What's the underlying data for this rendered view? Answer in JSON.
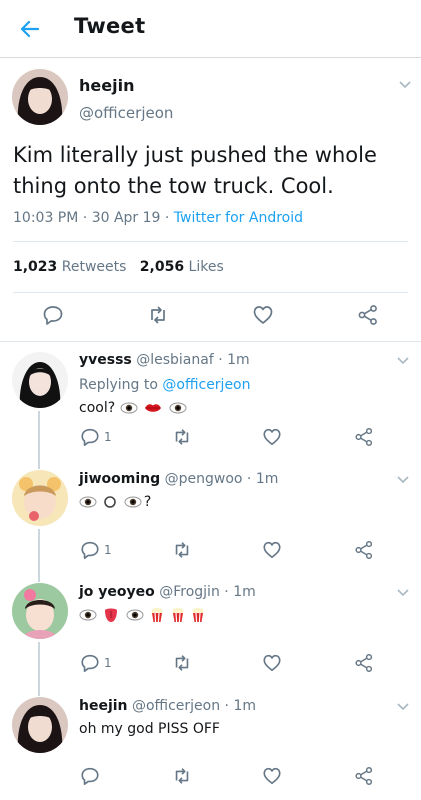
{
  "header": {
    "title": "Tweet",
    "back_icon": "arrow-left-icon",
    "accent": "#1da1f2"
  },
  "tweet": {
    "name": "heejin",
    "handle": "@officerjeon",
    "text": "Kim literally just pushed the whole thing onto the tow truck. Cool.",
    "time": "10:03 PM",
    "date": "30 Apr 19",
    "source": "Twitter for Android",
    "retweets_count": "1,023",
    "retweets_label": "Retweets",
    "likes_count": "2,056",
    "likes_label": "Likes"
  },
  "replies": [
    {
      "name": "yvesss",
      "handle": "@lesbianaf",
      "time": "1m",
      "replying_label": "Replying to",
      "replying_to": "@officerjeon",
      "text": "cool?",
      "emojis": [
        "eyes",
        "lips",
        "eyes"
      ],
      "reply_count": "1"
    },
    {
      "name": "jiwooming",
      "handle": "@pengwoo",
      "time": "1m",
      "text": "?",
      "emojis": [
        "eyes",
        "o",
        "eyes"
      ],
      "reply_count": "1"
    },
    {
      "name": "jo yeoyeo",
      "handle": "@Frogjin",
      "time": "1m",
      "text": "",
      "emojis": [
        "eyes",
        "tongue",
        "eyes",
        "popcorn",
        "popcorn",
        "popcorn"
      ],
      "reply_count": "1"
    },
    {
      "name": "heejin",
      "handle": "@officerjeon",
      "time": "1m",
      "text": "oh my god PISS OFF"
    }
  ]
}
